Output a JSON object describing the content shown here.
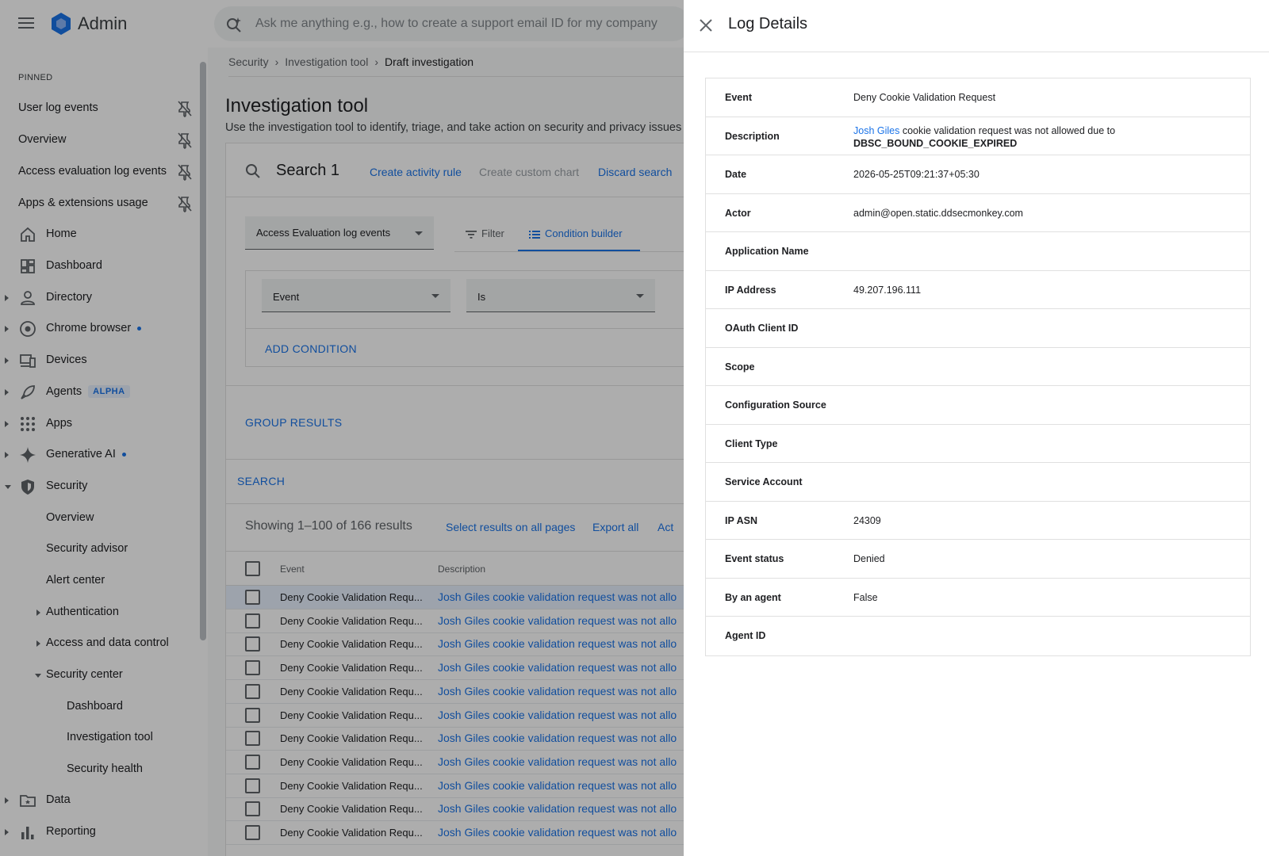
{
  "header": {
    "brand": "Admin",
    "search_placeholder": "Ask me anything e.g., how to create a support email ID for my company"
  },
  "sidebar": {
    "pinned_label": "PINNED",
    "pinned": [
      {
        "label": "User log events"
      },
      {
        "label": "Overview"
      },
      {
        "label": "Access evaluation log events"
      },
      {
        "label": "Apps & extensions usage"
      }
    ],
    "items": [
      {
        "label": "Home",
        "icon": "home-icon"
      },
      {
        "label": "Dashboard",
        "icon": "dashboard-icon"
      },
      {
        "label": "Directory",
        "icon": "person-icon"
      },
      {
        "label": "Chrome browser",
        "icon": "chrome-icon"
      },
      {
        "label": "Devices",
        "icon": "devices-icon"
      },
      {
        "label": "Agents",
        "icon": "rocket-icon",
        "badge": "ALPHA"
      },
      {
        "label": "Apps",
        "icon": "apps-grid-icon"
      },
      {
        "label": "Generative AI",
        "icon": "sparkle-icon"
      },
      {
        "label": "Security",
        "icon": "shield-icon"
      },
      {
        "label": "Overview"
      },
      {
        "label": "Security advisor"
      },
      {
        "label": "Alert center"
      },
      {
        "label": "Authentication"
      },
      {
        "label": "Access and data control"
      },
      {
        "label": "Security center"
      },
      {
        "label": "Dashboard"
      },
      {
        "label": "Investigation tool"
      },
      {
        "label": "Security health"
      },
      {
        "label": "Data",
        "icon": "folder-icon"
      },
      {
        "label": "Reporting",
        "icon": "bar-chart-icon"
      }
    ]
  },
  "breadcrumb": {
    "items": [
      "Security",
      "Investigation tool"
    ],
    "current": "Draft investigation"
  },
  "page": {
    "title": "Investigation tool",
    "subtitle": "Use the investigation tool to identify, triage, and take action on security and privacy issues"
  },
  "search_card": {
    "title": "Search 1",
    "create_activity_rule": "Create activity rule",
    "create_custom_chart": "Create custom chart",
    "discard_search": "Discard search",
    "data_source": "Access Evaluation log events",
    "filter_tab": "Filter",
    "condition_builder_tab": "Condition builder",
    "condition_field": "Event",
    "condition_operator": "Is",
    "add_condition": "ADD CONDITION",
    "group_results": "GROUP RESULTS",
    "search_button": "SEARCH"
  },
  "results": {
    "showing": "Showing 1–100 of 166 results",
    "select_all_pages": "Select results on all pages",
    "export_all": "Export all",
    "actions_partial": "Act",
    "columns": [
      "Event",
      "Description"
    ],
    "rows": [
      {
        "event": "Deny Cookie Validation Requ...",
        "description": "Josh Giles cookie validation request was not allo"
      },
      {
        "event": "Deny Cookie Validation Requ...",
        "description": "Josh Giles cookie validation request was not allo"
      },
      {
        "event": "Deny Cookie Validation Requ...",
        "description": "Josh Giles cookie validation request was not allo"
      },
      {
        "event": "Deny Cookie Validation Requ...",
        "description": "Josh Giles cookie validation request was not allo"
      },
      {
        "event": "Deny Cookie Validation Requ...",
        "description": "Josh Giles cookie validation request was not allo"
      },
      {
        "event": "Deny Cookie Validation Requ...",
        "description": "Josh Giles cookie validation request was not allo"
      },
      {
        "event": "Deny Cookie Validation Requ...",
        "description": "Josh Giles cookie validation request was not allo"
      },
      {
        "event": "Deny Cookie Validation Requ...",
        "description": "Josh Giles cookie validation request was not allo"
      },
      {
        "event": "Deny Cookie Validation Requ...",
        "description": "Josh Giles cookie validation request was not allo"
      },
      {
        "event": "Deny Cookie Validation Requ...",
        "description": "Josh Giles cookie validation request was not allo"
      },
      {
        "event": "Deny Cookie Validation Requ...",
        "description": "Josh Giles cookie validation request was not allo"
      }
    ]
  },
  "log_details": {
    "title": "Log Details",
    "rows": [
      {
        "key": "Event",
        "value": "Deny Cookie Validation Request"
      },
      {
        "key": "Description",
        "link": "Josh Giles",
        "text": " cookie validation request was not allowed due to",
        "strong": "DBSC_BOUND_COOKIE_EXPIRED"
      },
      {
        "key": "Date",
        "value": "2026-05-25T09:21:37+05:30"
      },
      {
        "key": "Actor",
        "value": "admin@open.static.ddsecmonkey.com"
      },
      {
        "key": "Application Name",
        "value": ""
      },
      {
        "key": "IP Address",
        "value": "49.207.196.111"
      },
      {
        "key": "OAuth Client ID",
        "value": ""
      },
      {
        "key": "Scope",
        "value": ""
      },
      {
        "key": "Configuration Source",
        "value": ""
      },
      {
        "key": "Client Type",
        "value": ""
      },
      {
        "key": "Service Account",
        "value": ""
      },
      {
        "key": "IP ASN",
        "value": "24309"
      },
      {
        "key": "Event status",
        "value": "Denied"
      },
      {
        "key": "By an agent",
        "value": "False"
      },
      {
        "key": "Agent ID",
        "value": ""
      }
    ]
  }
}
